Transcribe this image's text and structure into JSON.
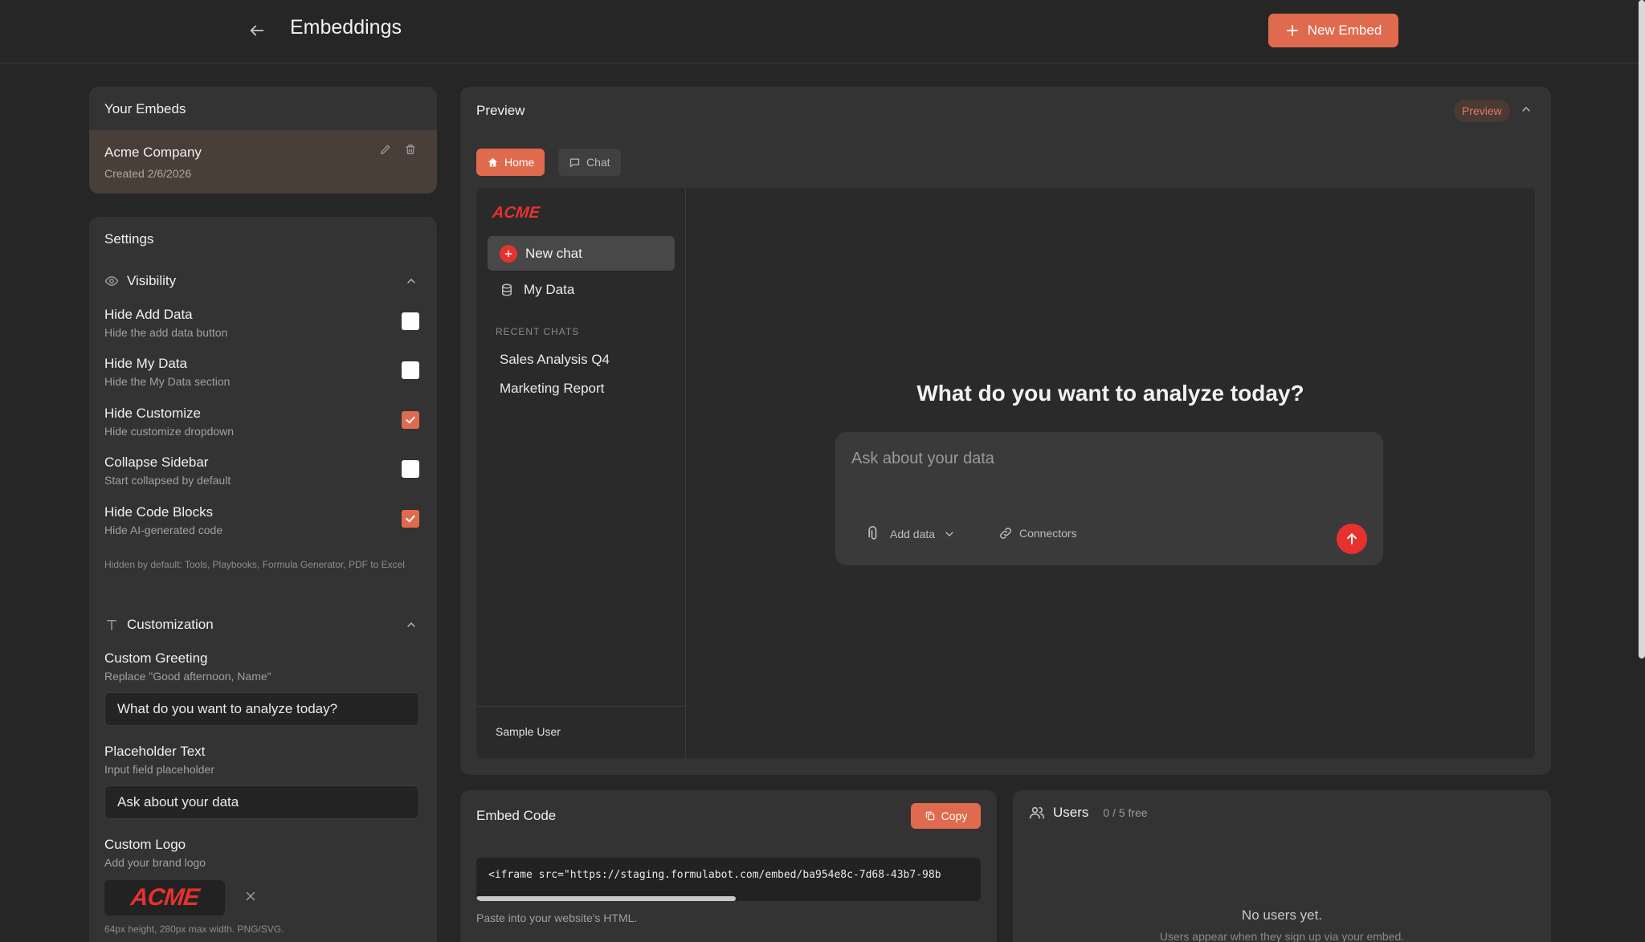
{
  "header": {
    "title": "Embeddings",
    "new_embed_label": "New Embed"
  },
  "embeds": {
    "title": "Your Embeds",
    "items": [
      {
        "name": "Acme Company",
        "created": "Created 2/6/2026"
      }
    ]
  },
  "settings": {
    "title": "Settings",
    "visibility": {
      "title": "Visibility",
      "options": [
        {
          "label": "Hide Add Data",
          "desc": "Hide the add data button",
          "checked": false
        },
        {
          "label": "Hide My Data",
          "desc": "Hide the My Data section",
          "checked": false
        },
        {
          "label": "Hide Customize",
          "desc": "Hide customize dropdown",
          "checked": true
        },
        {
          "label": "Collapse Sidebar",
          "desc": "Start collapsed by default",
          "checked": false
        },
        {
          "label": "Hide Code Blocks",
          "desc": "Hide AI-generated code",
          "checked": true
        }
      ],
      "hint": "Hidden by default: Tools, Playbooks, Formula Generator, PDF to Excel"
    },
    "customization": {
      "title": "Customization",
      "greeting_label": "Custom Greeting",
      "greeting_desc": "Replace \"Good afternoon, Name\"",
      "greeting_value": "What do you want to analyze today?",
      "placeholder_label": "Placeholder Text",
      "placeholder_desc": "Input field placeholder",
      "placeholder_value": "Ask about your data",
      "logo_label": "Custom Logo",
      "logo_desc": "Add your brand logo",
      "logo_text": "ACME",
      "logo_hint": "64px height, 280px max width. PNG/SVG."
    }
  },
  "preview": {
    "title": "Preview",
    "badge": "Preview",
    "tabs": [
      {
        "label": "Home",
        "active": true
      },
      {
        "label": "Chat",
        "active": false
      }
    ],
    "app": {
      "logo": "ACME",
      "new_chat": "New chat",
      "my_data": "My Data",
      "recent_heading": "RECENT CHATS",
      "recent": [
        "Sales Analysis Q4",
        "Marketing Report"
      ],
      "user": "Sample User",
      "greeting": "What do you want to analyze today?",
      "input_placeholder": "Ask about your data",
      "add_data": "Add data",
      "connectors": "Connectors"
    }
  },
  "embed_code": {
    "title": "Embed Code",
    "copy_label": "Copy",
    "code": "<iframe src=\"https://staging.formulabot.com/embed/ba954e8c-7d68-43b7-98b",
    "hint": "Paste into your website's HTML."
  },
  "users": {
    "title": "Users",
    "count": "0 / 5 free",
    "empty": "No users yet.",
    "empty_sub": "Users appear when they sign up via your embed."
  },
  "colors": {
    "accent": "#e06a4e",
    "brand_red": "#e5322f",
    "background": "#262626",
    "card": "#333333"
  },
  "icons": [
    "arrow-left-icon",
    "plus-icon",
    "pencil-icon",
    "trash-icon",
    "eye-icon",
    "chevron-up-icon",
    "text-icon",
    "close-icon",
    "home-icon",
    "chat-icon",
    "database-icon",
    "paperclip-icon",
    "chevron-down-icon",
    "link-icon",
    "arrow-up-icon",
    "copy-icon",
    "users-icon"
  ]
}
